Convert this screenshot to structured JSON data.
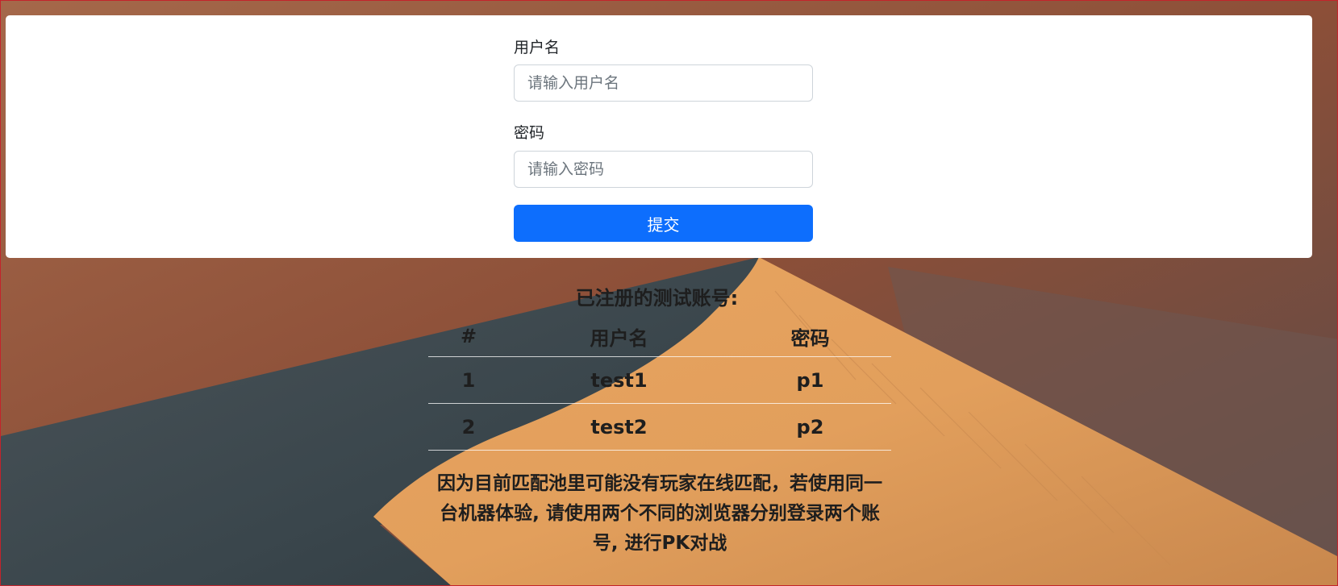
{
  "login_form": {
    "username_label": "用户名",
    "username_placeholder": "请输入用户名",
    "username_value": "",
    "password_label": "密码",
    "password_placeholder": "请输入密码",
    "password_value": "",
    "submit_label": "提交"
  },
  "test_accounts": {
    "title": "已注册的测试账号:",
    "headers": [
      "#",
      "用户名",
      "密码"
    ],
    "rows": [
      [
        "1",
        "test1",
        "p1"
      ],
      [
        "2",
        "test2",
        "p2"
      ]
    ]
  },
  "notice": "因为目前匹配池里可能没有玩家在线匹配，若使用同一台机器体验, 请使用两个不同的浏览器分别登录两个账号, 进行PK对战",
  "colors": {
    "primary": "#0d6efd",
    "card_bg": "#ffffff",
    "text_dark": "#1e1e1e"
  }
}
